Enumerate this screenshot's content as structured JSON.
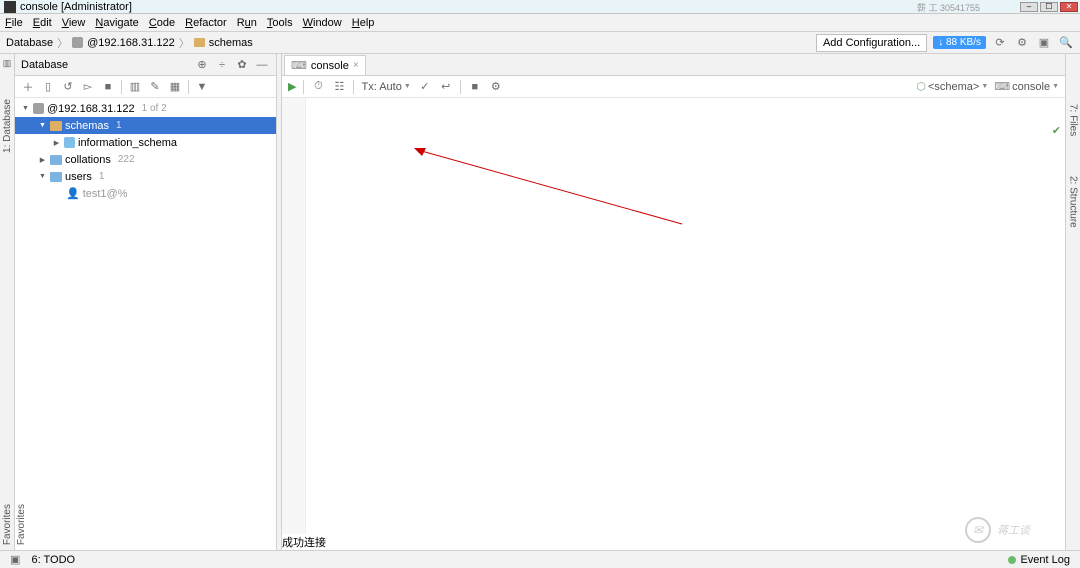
{
  "window": {
    "title": "console [Administrator]"
  },
  "menu": [
    "File",
    "Edit",
    "View",
    "Navigate",
    "Code",
    "Refactor",
    "Run",
    "Tools",
    "Window",
    "Help"
  ],
  "breadcrumb": {
    "root": "Database",
    "conn": "@192.168.31.122",
    "leaf": "schemas"
  },
  "nav_right": {
    "add_config": "Add Configuration...",
    "pill": "↓ 88 KB/s"
  },
  "db_panel": {
    "title": "Database"
  },
  "tree": {
    "conn": {
      "label": "@192.168.31.122",
      "count": "1 of 2"
    },
    "schemas": {
      "label": "schemas",
      "count": "1"
    },
    "info": {
      "label": "information_schema"
    },
    "collations": {
      "label": "collations",
      "count": "222"
    },
    "users": {
      "label": "users",
      "count": "1"
    },
    "test1": {
      "label": "test1@%"
    }
  },
  "tab": {
    "label": "console"
  },
  "editor_toolbar": {
    "tx": "Tx: Auto"
  },
  "editor_dd": {
    "schema": "<schema>",
    "console": "console"
  },
  "annotation": "成功连接",
  "status": {
    "todo": "6: TODO",
    "event_log": "Event Log"
  },
  "gutter": {
    "left": "1: Database",
    "right_files": "7: Files",
    "right_struct": "2: Structure",
    "fav": "Favorites"
  },
  "watermark": "蒋工谈",
  "perf_tag": "薪 工 30541755"
}
